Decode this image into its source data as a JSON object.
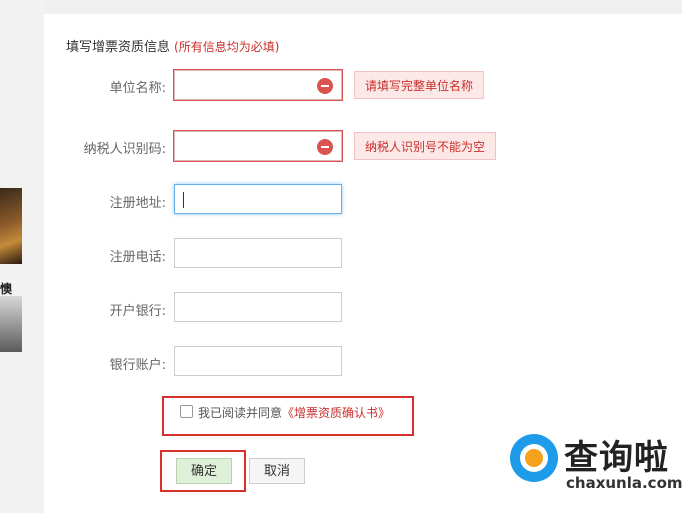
{
  "form": {
    "title": "填写增票资质信息",
    "required_note": "(所有信息均为必填)",
    "fields": [
      {
        "label": "单位名称:",
        "value": "",
        "error": "请填写完整单位名称"
      },
      {
        "label": "纳税人识别码:",
        "value": "",
        "error": "纳税人识别号不能为空"
      },
      {
        "label": "注册地址:",
        "value": ""
      },
      {
        "label": "注册电话:",
        "value": ""
      },
      {
        "label": "开户银行:",
        "value": ""
      },
      {
        "label": "银行账户:",
        "value": ""
      }
    ],
    "agree": {
      "checked": false,
      "text": "我已阅读并同意",
      "link": "《增票资质确认书》"
    },
    "buttons": {
      "confirm": "确定",
      "cancel": "取消"
    }
  },
  "sidebar": {
    "partial_text": "懊"
  },
  "watermark": {
    "brand": "查询啦",
    "url": "chaxunla.com",
    "colors": {
      "ring": "#1e9be9",
      "dot": "#f7a11a"
    }
  },
  "colors": {
    "error": "#d9534f",
    "highlight": "#d9302c",
    "focus": "#66afe9"
  }
}
